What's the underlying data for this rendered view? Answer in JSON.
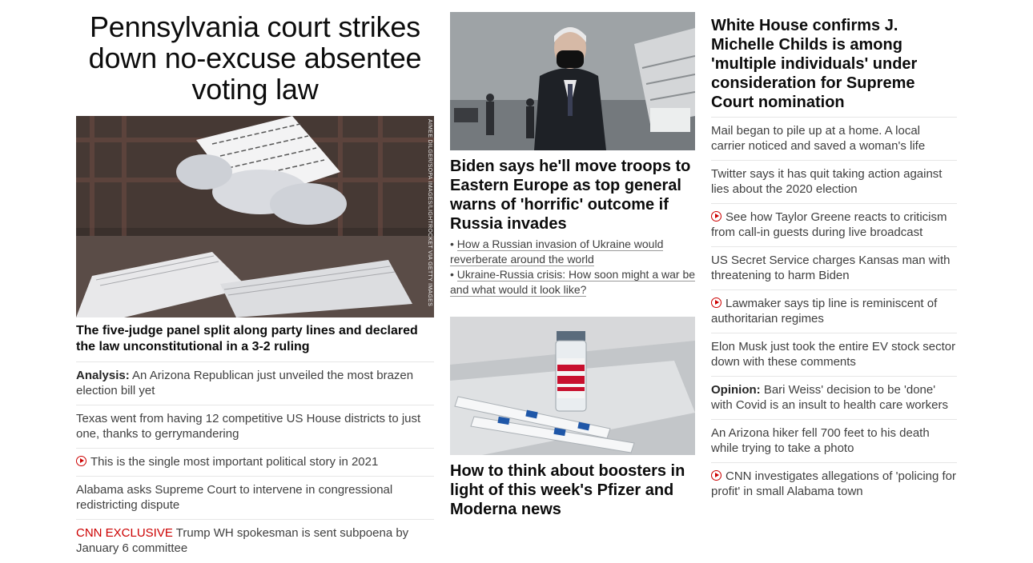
{
  "col1": {
    "headline": "Pennsylvania court strikes down no-excuse absentee voting law",
    "photo_credit": "AIMEE DILGER/SOPA IMAGES/LIGHTROCKET VIA GETTY IMAGES",
    "subhead": "The five-judge panel split along party lines and declared the law unconstitutional in a 3-2 ruling",
    "items": [
      {
        "prefix": "Analysis:",
        "text": "An Arizona Republican just unveiled the most brazen election bill yet"
      },
      {
        "text": "Texas went from having 12 competitive US House districts to just one, thanks to gerrymandering"
      },
      {
        "text": "This is the single most important political story in 2021"
      },
      {
        "text": "Alabama asks Supreme Court to intervene in congressional redistricting dispute"
      },
      {
        "prefix": "CNN EXCLUSIVE",
        "text": "Trump WH spokesman is sent subpoena by January 6 committee"
      }
    ]
  },
  "col2": {
    "story1": {
      "headline": "Biden says he'll move troops to Eastern Europe as top general warns of 'horrific' outcome if Russia invades",
      "bullets": [
        "How a Russian invasion of Ukraine would reverberate around the world",
        "Ukraine-Russia crisis: How soon might a war be and what would it look like?"
      ]
    },
    "story2": {
      "headline": "How to think about boosters in light of this week's Pfizer and Moderna news"
    }
  },
  "col3": {
    "headline": "White House confirms J. Michelle Childs is among 'multiple individuals' under consideration for Supreme Court nomination",
    "items": [
      {
        "text": "Mail began to pile up at a home. A local carrier noticed and saved a woman's life"
      },
      {
        "text": "Twitter says it has quit taking action against lies about the 2020 election"
      },
      {
        "text": "See how Taylor Greene reacts to criticism from call-in guests during live broadcast"
      },
      {
        "text": "US Secret Service charges Kansas man with threatening to harm Biden"
      },
      {
        "text": "Lawmaker says tip line is reminiscent of authoritarian regimes"
      },
      {
        "text": "Elon Musk just took the entire EV stock sector down with these comments"
      },
      {
        "prefix": "Opinion:",
        "text": "Bari Weiss' decision to be 'done' with Covid is an insult to health care workers"
      },
      {
        "text": "An Arizona hiker fell 700 feet to his death while trying to take a photo"
      },
      {
        "text": "CNN investigates allegations of 'policing for profit' in small Alabama town"
      }
    ]
  },
  "icons": {
    "video": "play-circle-icon"
  },
  "colors": {
    "accent_red": "#cc0000",
    "text": "#262626",
    "divider": "#e6e6e6"
  }
}
